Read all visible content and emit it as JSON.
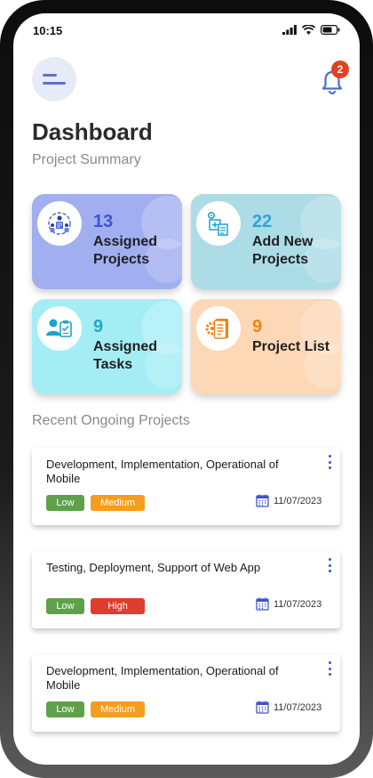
{
  "status_bar": {
    "time": "10:15"
  },
  "header": {
    "notification_count": "2"
  },
  "page": {
    "title": "Dashboard",
    "subtitle": "Project Summary"
  },
  "summary_cards": [
    {
      "count": "13",
      "label": "Assigned Projects",
      "icon": "team-icon",
      "color": "#a1aef0"
    },
    {
      "count": "22",
      "label": "Add New Projects",
      "icon": "add-project-icon",
      "color": "#acdce6"
    },
    {
      "count": "9",
      "label": "Assigned Tasks",
      "icon": "task-assign-icon",
      "color": "#a5edf5"
    },
    {
      "count": "9",
      "label": "Project List",
      "icon": "document-gear-icon",
      "color": "#fdd8b7"
    }
  ],
  "recent": {
    "title": "Recent Ongoing Projects",
    "items": [
      {
        "name": "Development, Implementation, Operational of Mobile",
        "tags": [
          "Low",
          "Medium"
        ],
        "date": "11/07/2023"
      },
      {
        "name": "Testing, Deployment, Support of Web App",
        "tags": [
          "Low",
          "High"
        ],
        "date": "11/07/2023"
      },
      {
        "name": "Development, Implementation, Operational of Mobile",
        "tags": [
          "Low",
          "Medium"
        ],
        "date": "11/07/2023"
      }
    ]
  },
  "colors": {
    "accent": "#3e54cf",
    "low": "#5fa14b",
    "medium": "#f59d1e",
    "high": "#e23b2f",
    "badge": "#e0421f"
  }
}
